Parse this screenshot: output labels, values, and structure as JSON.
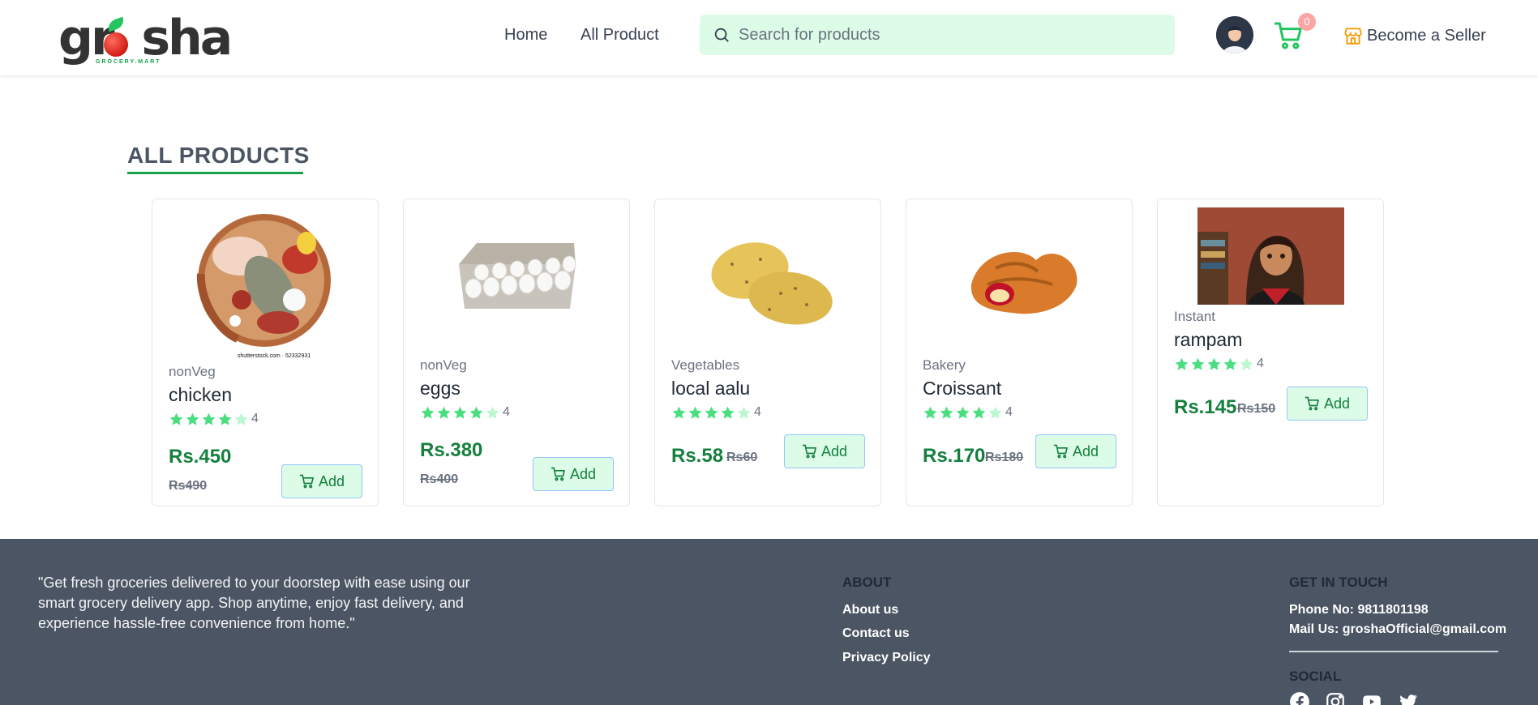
{
  "brand": {
    "logo_text": "grosha",
    "tagline": "GROCERY.MART"
  },
  "nav": {
    "home": "Home",
    "all_product": "All Product"
  },
  "search": {
    "placeholder": "Search for products",
    "value": ""
  },
  "cart": {
    "count": "0"
  },
  "seller": {
    "label": "Become a Seller"
  },
  "section": {
    "title": "ALL PRODUCTS"
  },
  "colors": {
    "accent": "#16a34a",
    "price": "#15803d",
    "search_bg": "#dcfce7",
    "footer_bg": "#4b5563",
    "star": "#4ade80"
  },
  "products": [
    {
      "category": "nonVeg",
      "name": "chicken",
      "rating": "4",
      "rating_value": 4,
      "price": "Rs.450",
      "old_price": "Rs490",
      "add_label": "Add",
      "image": "meat-platter-image",
      "image_caption": "shutterstock.com · 52332931"
    },
    {
      "category": "nonVeg",
      "name": "eggs",
      "rating": "4",
      "rating_value": 4,
      "price": "Rs.380",
      "old_price": "Rs400",
      "add_label": "Add",
      "image": "egg-carton-image"
    },
    {
      "category": "Vegetables",
      "name": "local aalu",
      "rating": "4",
      "rating_value": 4,
      "price": "Rs.58",
      "old_price": "Rs60",
      "add_label": "Add",
      "image": "potatoes-image"
    },
    {
      "category": "Bakery",
      "name": "Croissant",
      "rating": "4",
      "rating_value": 4,
      "price": "Rs.170",
      "old_price": "Rs180",
      "add_label": "Add",
      "image": "croissant-image"
    },
    {
      "category": "Instant",
      "name": "rampam",
      "rating": "4",
      "rating_value": 4,
      "price": "Rs.145",
      "old_price": "Rs150",
      "add_label": "Add",
      "image": "anime-girl-image"
    }
  ],
  "footer": {
    "quote": "\"Get fresh groceries delivered to your doorstep with ease using our smart grocery delivery app. Shop anytime, enjoy fast delivery, and experience hassle-free convenience from home.\"",
    "about": {
      "heading": "ABOUT",
      "links": [
        "About us",
        "Contact us",
        "Privacy Policy"
      ]
    },
    "contact": {
      "heading": "GET IN TOUCH",
      "phone": "Phone No: 9811801198",
      "mail": "Mail Us: groshaOfficial@gmail.com"
    },
    "social": {
      "heading": "SOCIAL",
      "icons": [
        "facebook-icon",
        "instagram-icon",
        "youtube-icon",
        "twitter-icon"
      ]
    }
  }
}
